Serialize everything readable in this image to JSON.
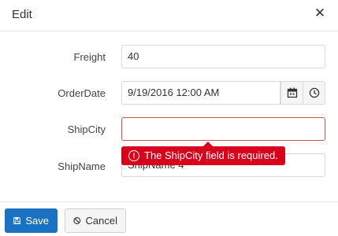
{
  "dialog": {
    "title": "Edit",
    "close_icon": "close-icon"
  },
  "fields": {
    "freight": {
      "label": "Freight",
      "value": "40"
    },
    "order_date": {
      "label": "OrderDate",
      "value": "9/19/2016 12:00 AM"
    },
    "ship_city": {
      "label": "ShipCity",
      "value": ""
    },
    "ship_name": {
      "label": "ShipName",
      "value": "ShipName 4"
    }
  },
  "validation": {
    "message": "The ShipCity field is required.",
    "icon": "exclamation-circle-icon"
  },
  "buttons": {
    "save_label": "Save",
    "cancel_label": "Cancel"
  },
  "colors": {
    "error": "#d9001b",
    "primary": "#1a73c2"
  }
}
